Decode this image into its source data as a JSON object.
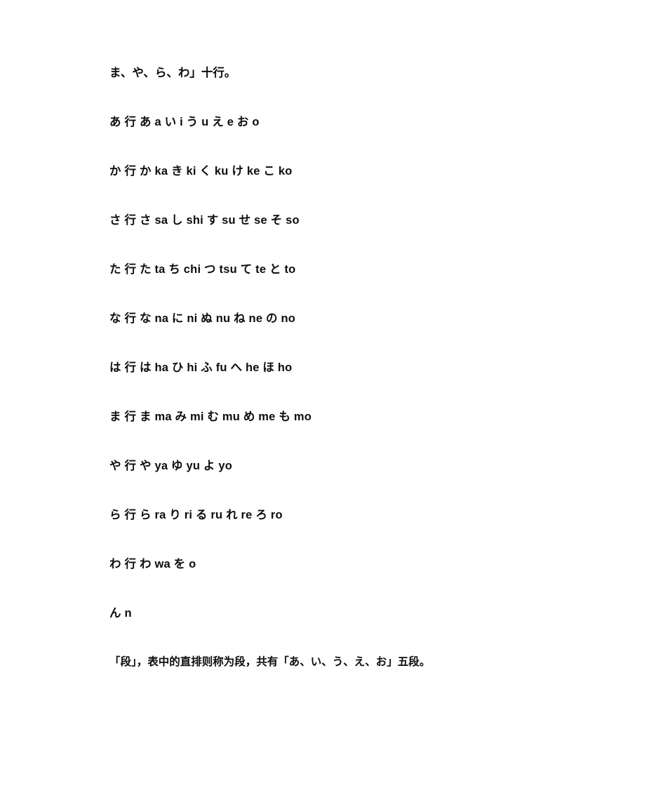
{
  "document": {
    "background_color": "#ffffff",
    "text_color": "#0d0d0f",
    "lines": [
      {
        "id": "intro-tail",
        "kind": "sentence",
        "text": "ま、や、ら、わ」十行。"
      },
      {
        "id": "row-a",
        "kind": "gojuon-row",
        "row_label": "あ 行",
        "text": "あ 行 あ a い i う u え e お o"
      },
      {
        "id": "row-ka",
        "kind": "gojuon-row",
        "row_label": "か 行",
        "text": "か 行 か ka き ki く ku け ke こ ko"
      },
      {
        "id": "row-sa",
        "kind": "gojuon-row",
        "row_label": "さ 行",
        "text": "さ 行 さ sa し shi す su せ se そ so"
      },
      {
        "id": "row-ta",
        "kind": "gojuon-row",
        "row_label": "た 行",
        "text": "た 行 た ta ち chi つ tsu て te と to"
      },
      {
        "id": "row-na",
        "kind": "gojuon-row",
        "row_label": "な 行",
        "text": "な 行 な na に ni ぬ nu ね ne の no"
      },
      {
        "id": "row-ha",
        "kind": "gojuon-row",
        "row_label": "は 行",
        "text": "は 行 は ha ひ hi ふ fu へ he ほ ho"
      },
      {
        "id": "row-ma",
        "kind": "gojuon-row",
        "row_label": "ま 行",
        "text": "ま 行 ま ma み mi む mu め me も mo"
      },
      {
        "id": "row-ya",
        "kind": "gojuon-row",
        "row_label": "や 行",
        "text": "や 行 や ya ゆ yu よ yo"
      },
      {
        "id": "row-ra",
        "kind": "gojuon-row",
        "row_label": "ら 行",
        "text": "ら 行 ら ra り ri る ru れ re ろ ro"
      },
      {
        "id": "row-wa",
        "kind": "gojuon-row",
        "row_label": "わ 行",
        "text": "わ 行 わ wa を o"
      },
      {
        "id": "row-n",
        "kind": "gojuon-row",
        "row_label": "ん",
        "text": "ん n"
      },
      {
        "id": "closing",
        "kind": "sentence",
        "text": "「段」，表中的直排则称为段，共有「あ、い、う、え、お」五段。"
      }
    ]
  }
}
